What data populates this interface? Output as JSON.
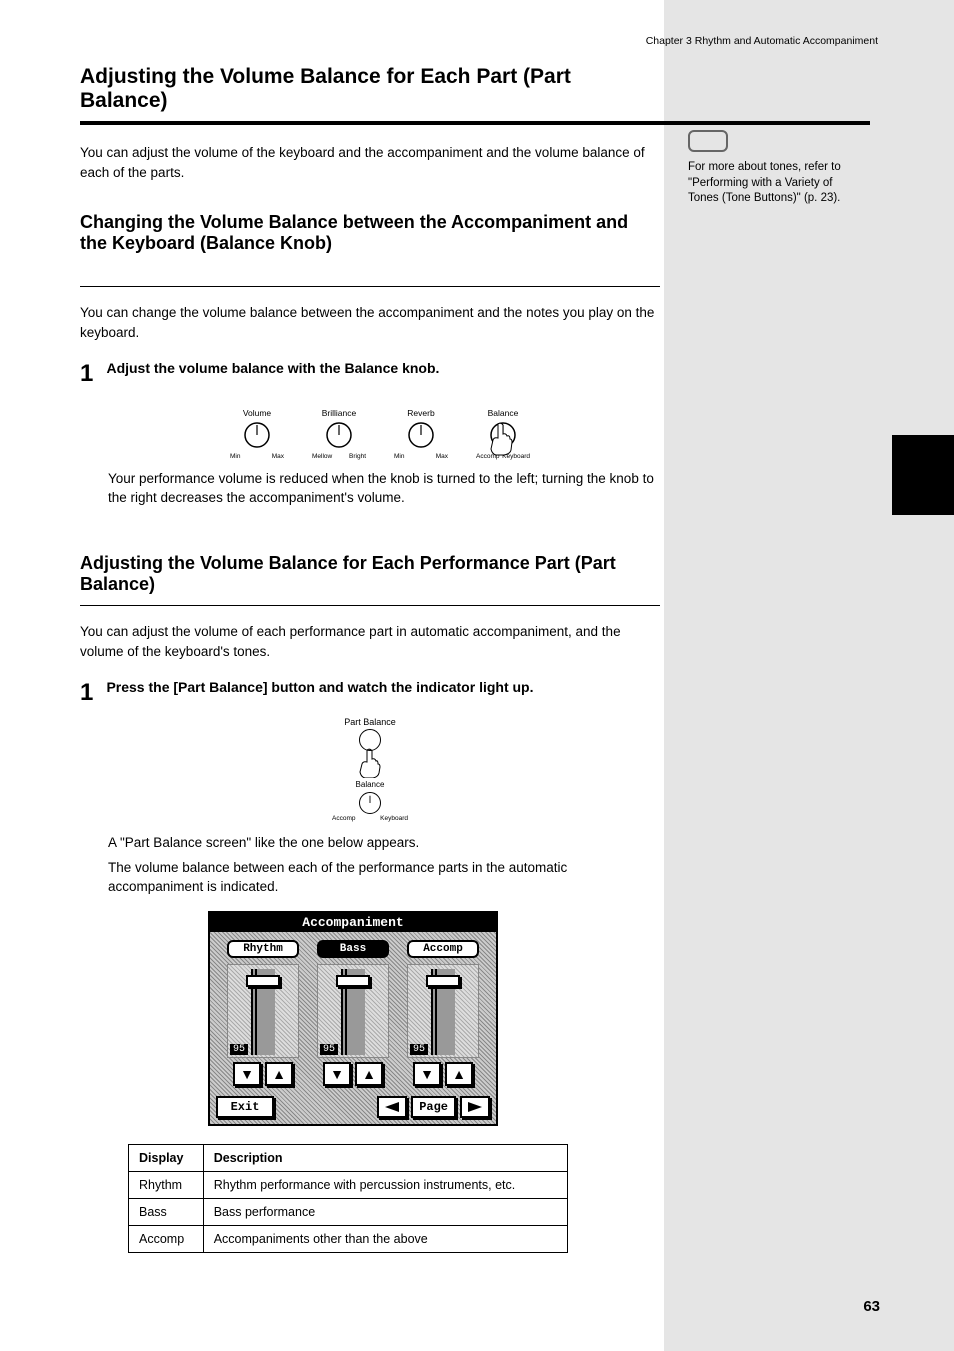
{
  "running_head": "Chapter 3 Rhythm and Automatic Accompaniment",
  "h1": "Adjusting the Volume Balance for Each Part (Part Balance)",
  "intro1": "You can adjust the volume of the keyboard and the accompaniment and the volume balance of each of the parts.",
  "h2a": "Changing the Volume Balance between the Accompaniment and the Keyboard (Balance Knob)",
  "body_a1": "You can change the volume balance between the accompaniment and the notes you play on the keyboard.",
  "step_a1_num": "1",
  "step_a1_text": "Adjust the volume balance with the Balance knob.",
  "knobs": [
    {
      "top": "Volume",
      "left": "Min",
      "right": "Max"
    },
    {
      "top": "Brilliance",
      "left": "Mellow",
      "right": "Bright"
    },
    {
      "top": "Reverb",
      "left": "Min",
      "right": "Max"
    },
    {
      "top": "Balance",
      "left": "Accomp",
      "right": "Keyboard"
    }
  ],
  "body_a2": "Your performance volume is reduced when the knob is turned to the left; turning the knob to the right decreases the accompaniment's volume.",
  "h2b": "Adjusting the Volume Balance for Each Performance Part (Part Balance)",
  "body_b1": "You can adjust the volume of each performance part in automatic accompaniment, and the volume of the keyboard's tones.",
  "step_b1_num": "1",
  "step_b1_text": "Press the [Part Balance] button and watch the indicator light up.",
  "pb_figure": {
    "top_label": "Part Balance",
    "mid_label": "Balance",
    "bl": "Accomp",
    "br": "Keyboard"
  },
  "body_b2": "A \"Part Balance screen\" like the one below appears.",
  "body_b3": "The volume balance between each of the performance parts in the automatic accompaniment is indicated.",
  "screen": {
    "title": "Accompaniment",
    "sliders": [
      {
        "label": "Rhythm",
        "value": "95"
      },
      {
        "label": "Bass",
        "value": "95"
      },
      {
        "label": "Accomp",
        "value": "95"
      }
    ],
    "exit": "Exit",
    "page": "Page"
  },
  "table_header": [
    "Display",
    "Description"
  ],
  "table_rows": [
    [
      "Rhythm",
      "Rhythm performance with percussion instruments, etc."
    ],
    [
      "Bass",
      "Bass performance"
    ],
    [
      "Accomp",
      "Accompaniments other than the above"
    ]
  ],
  "cross_ref": "For more about tones, refer to \"Performing with a Variety of Tones (Tone Buttons)\" (p. 23).",
  "page_number": "63"
}
